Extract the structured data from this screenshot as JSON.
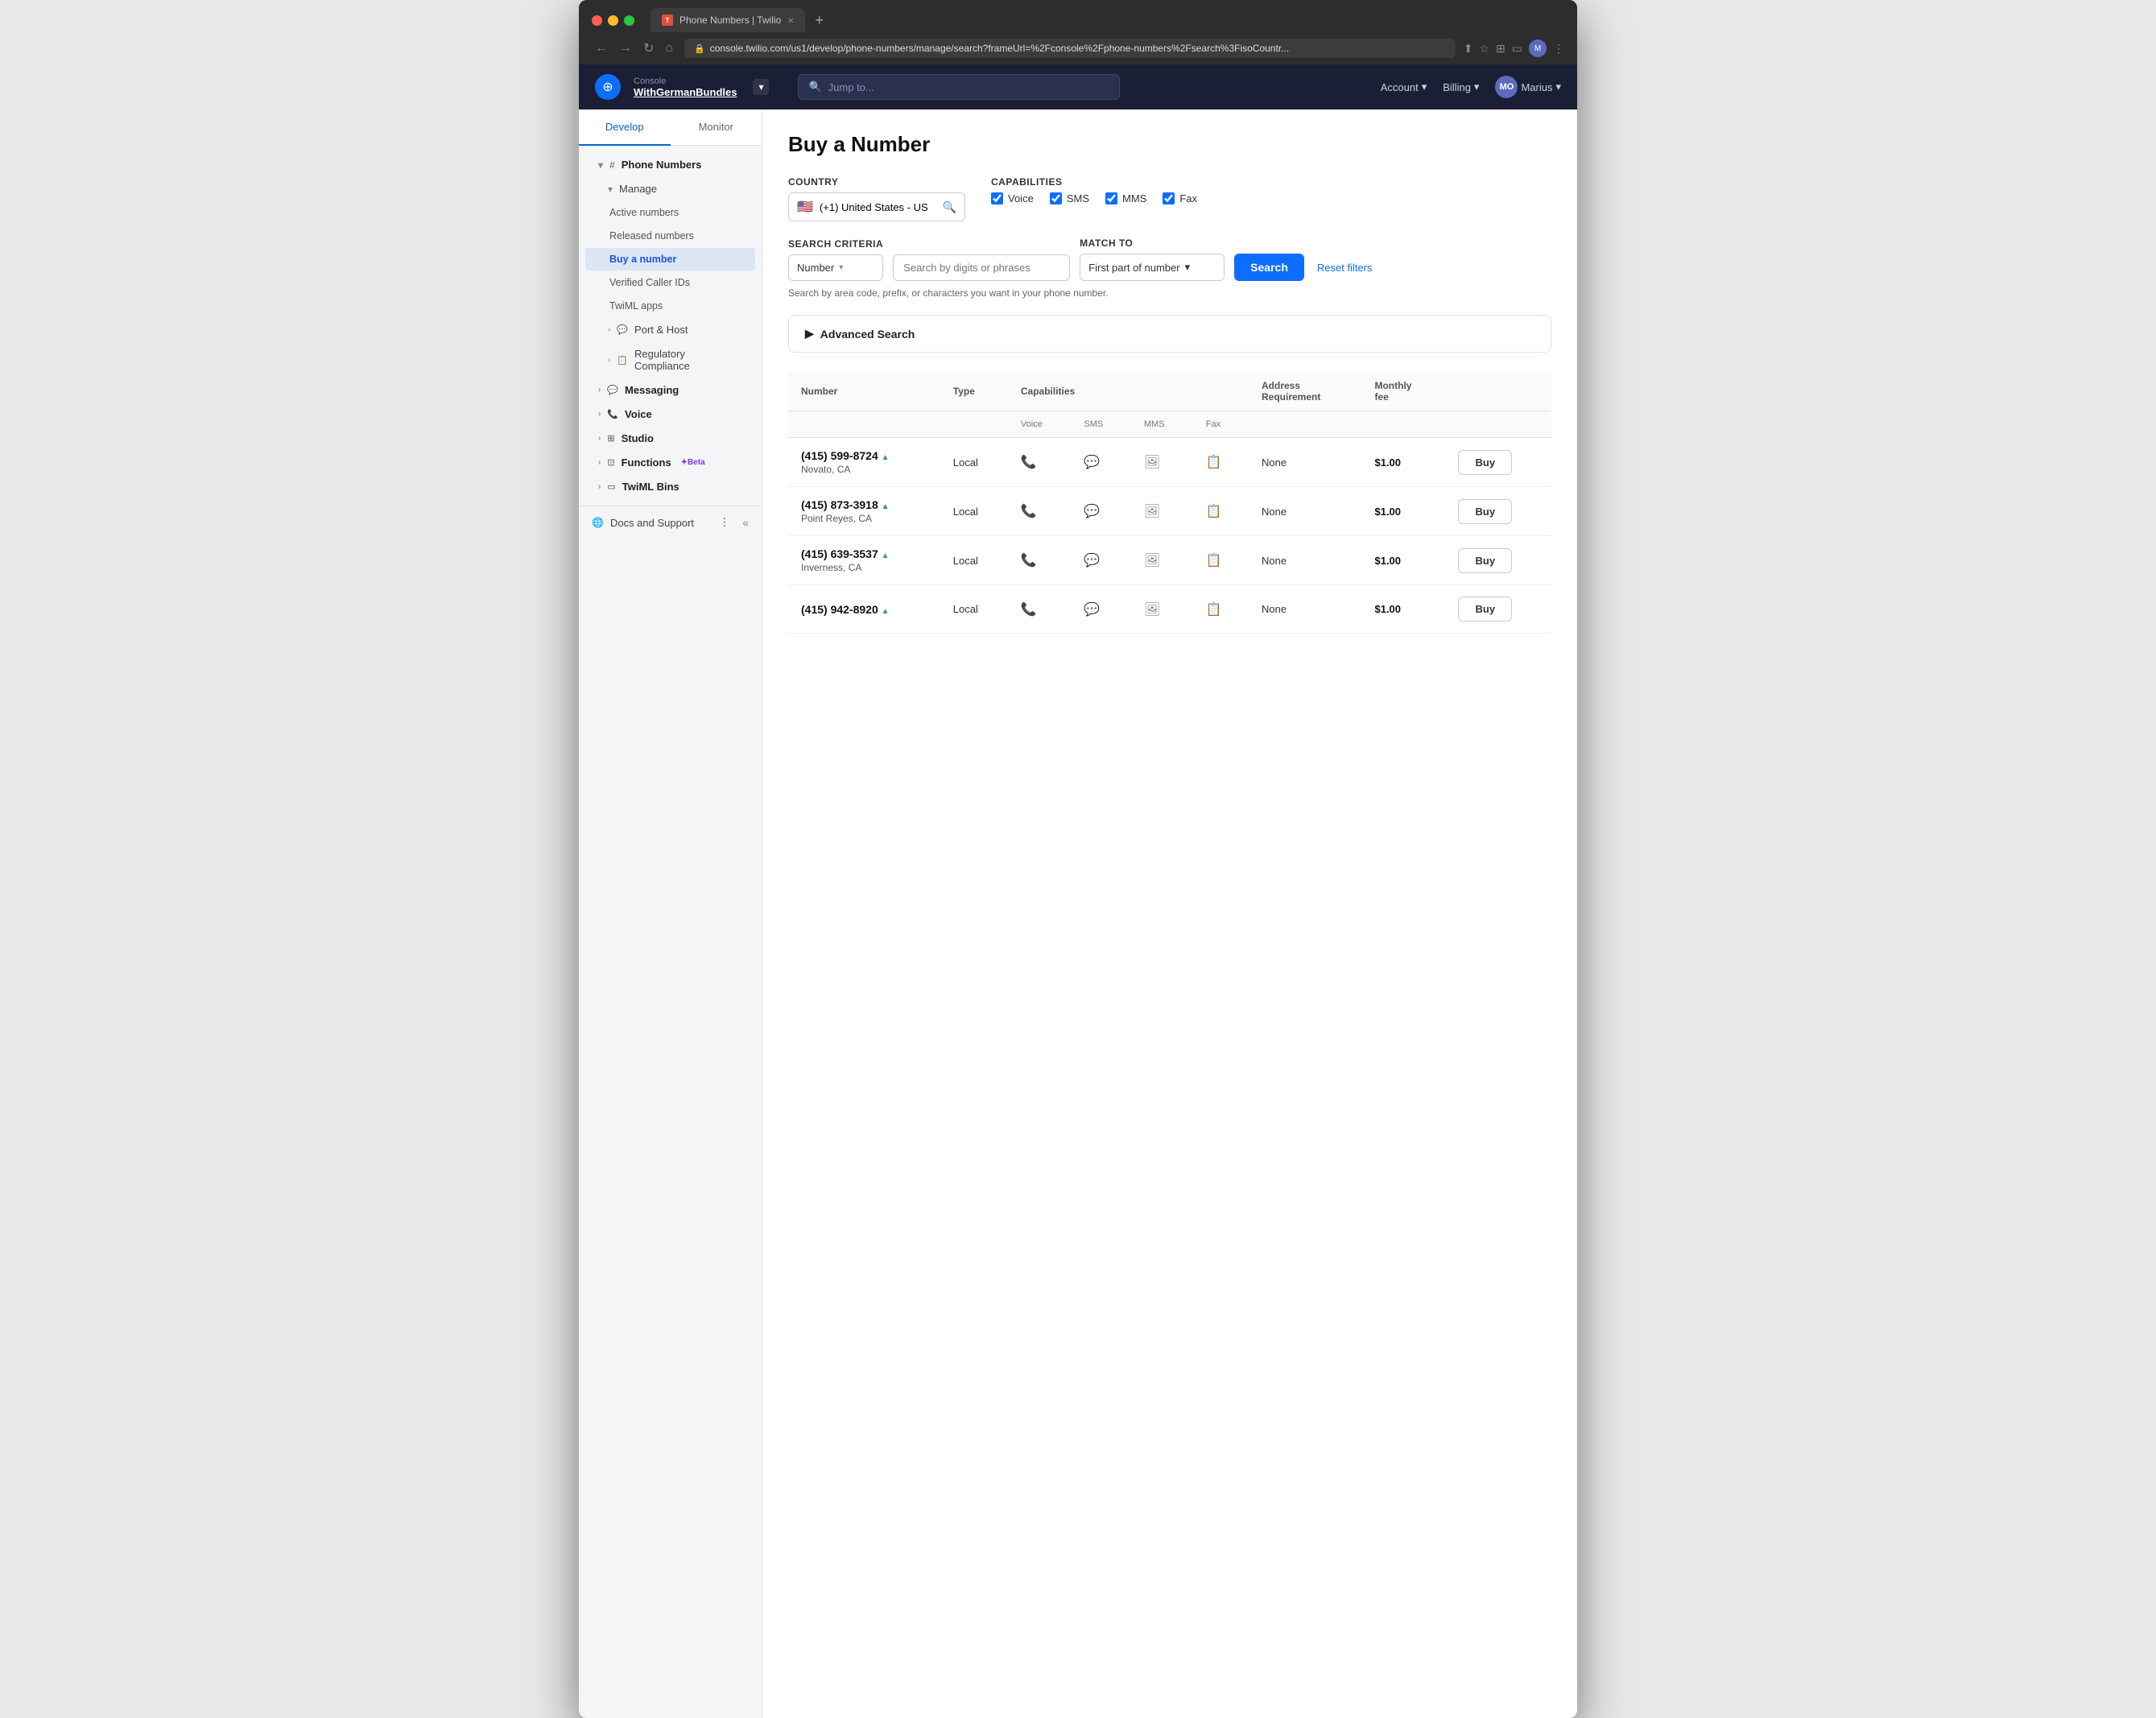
{
  "browser": {
    "tab_title": "Phone Numbers | Twilio",
    "address": "console.twilio.com/us1/develop/phone-numbers/manage/search?frameUrl=%2Fconsole%2Fphone-numbers%2Fsearch%3FisoCountr...",
    "new_tab_icon": "+"
  },
  "header": {
    "console_label": "Console",
    "account_name": "WithGermanBundles",
    "search_placeholder": "Jump to...",
    "account_label": "Account",
    "billing_label": "Billing",
    "user_label": "Marius",
    "user_initials": "MO"
  },
  "sidebar": {
    "tabs": [
      {
        "label": "Develop",
        "active": true
      },
      {
        "label": "Monitor",
        "active": false
      }
    ],
    "items": [
      {
        "label": "Phone Numbers",
        "icon": "#",
        "expanded": true,
        "level": 1
      },
      {
        "label": "Manage",
        "icon": "▾",
        "expanded": true,
        "level": 2
      },
      {
        "label": "Active numbers",
        "level": 3
      },
      {
        "label": "Released numbers",
        "level": 3
      },
      {
        "label": "Buy a number",
        "active": true,
        "level": 3
      },
      {
        "label": "Verified Caller IDs",
        "level": 3
      },
      {
        "label": "TwiML apps",
        "level": 3
      },
      {
        "label": "Port & Host",
        "icon": "›",
        "level": 2
      },
      {
        "label": "Regulatory Compliance",
        "icon": "›",
        "level": 2
      },
      {
        "label": "Messaging",
        "icon": "›",
        "level": 1
      },
      {
        "label": "Voice",
        "icon": "›",
        "level": 1
      },
      {
        "label": "Studio",
        "icon": "›",
        "level": 1
      },
      {
        "label": "Functions",
        "icon": "›",
        "level": 1,
        "badge": "Beta"
      },
      {
        "label": "TwiML Bins",
        "icon": "›",
        "level": 1
      }
    ],
    "footer": {
      "label": "Docs and Support",
      "more_icon": "⋮",
      "collapse_icon": "«"
    }
  },
  "page": {
    "title": "Buy a Number",
    "country_label": "Country",
    "country_value": "(+1) United States - US",
    "country_flag": "🇺🇸",
    "capabilities_label": "Capabilities",
    "capabilities": [
      {
        "label": "Voice",
        "checked": true
      },
      {
        "label": "SMS",
        "checked": true
      },
      {
        "label": "MMS",
        "checked": true
      },
      {
        "label": "Fax",
        "checked": true
      }
    ],
    "search_criteria_label": "Search criteria",
    "search_criteria_value": "Number",
    "search_placeholder": "Search by digits or phrases",
    "match_to_label": "Match to",
    "match_to_value": "First part of number",
    "search_btn": "Search",
    "reset_btn": "Reset filters",
    "search_hint": "Search by area code, prefix, or characters you want in your phone number.",
    "advanced_search_label": "Advanced Search",
    "table": {
      "columns": [
        {
          "label": "Number"
        },
        {
          "label": "Type"
        },
        {
          "label": "Capabilities"
        },
        {
          "label": ""
        },
        {
          "label": ""
        },
        {
          "label": ""
        },
        {
          "label": "Address Requirement"
        },
        {
          "label": "Monthly fee"
        },
        {
          "label": ""
        }
      ],
      "cap_sub_headers": [
        "Voice",
        "SMS",
        "MMS",
        "Fax"
      ],
      "rows": [
        {
          "number": "(415) 599-8724",
          "trend": "▲",
          "location": "Novato, CA",
          "type": "Local",
          "address_req": "None",
          "monthly_fee": "$1.00",
          "buy_label": "Buy"
        },
        {
          "number": "(415) 873-3918",
          "trend": "▲",
          "location": "Point Reyes, CA",
          "type": "Local",
          "address_req": "None",
          "monthly_fee": "$1.00",
          "buy_label": "Buy"
        },
        {
          "number": "(415) 639-3537",
          "trend": "▲",
          "location": "Inverness, CA",
          "type": "Local",
          "address_req": "None",
          "monthly_fee": "$1.00",
          "buy_label": "Buy"
        },
        {
          "number": "(415) 942-8920",
          "trend": "▲",
          "location": "",
          "type": "Local",
          "address_req": "None",
          "monthly_fee": "$1.00",
          "buy_label": "Buy"
        }
      ]
    }
  },
  "icons": {
    "phone": "📞",
    "sms": "💬",
    "mms": "🖼",
    "fax": "📋",
    "chevron_down": "▾",
    "chevron_right": "›",
    "search": "🔍",
    "globe": "🌐",
    "shield": "🛡",
    "zap": "⚡"
  }
}
